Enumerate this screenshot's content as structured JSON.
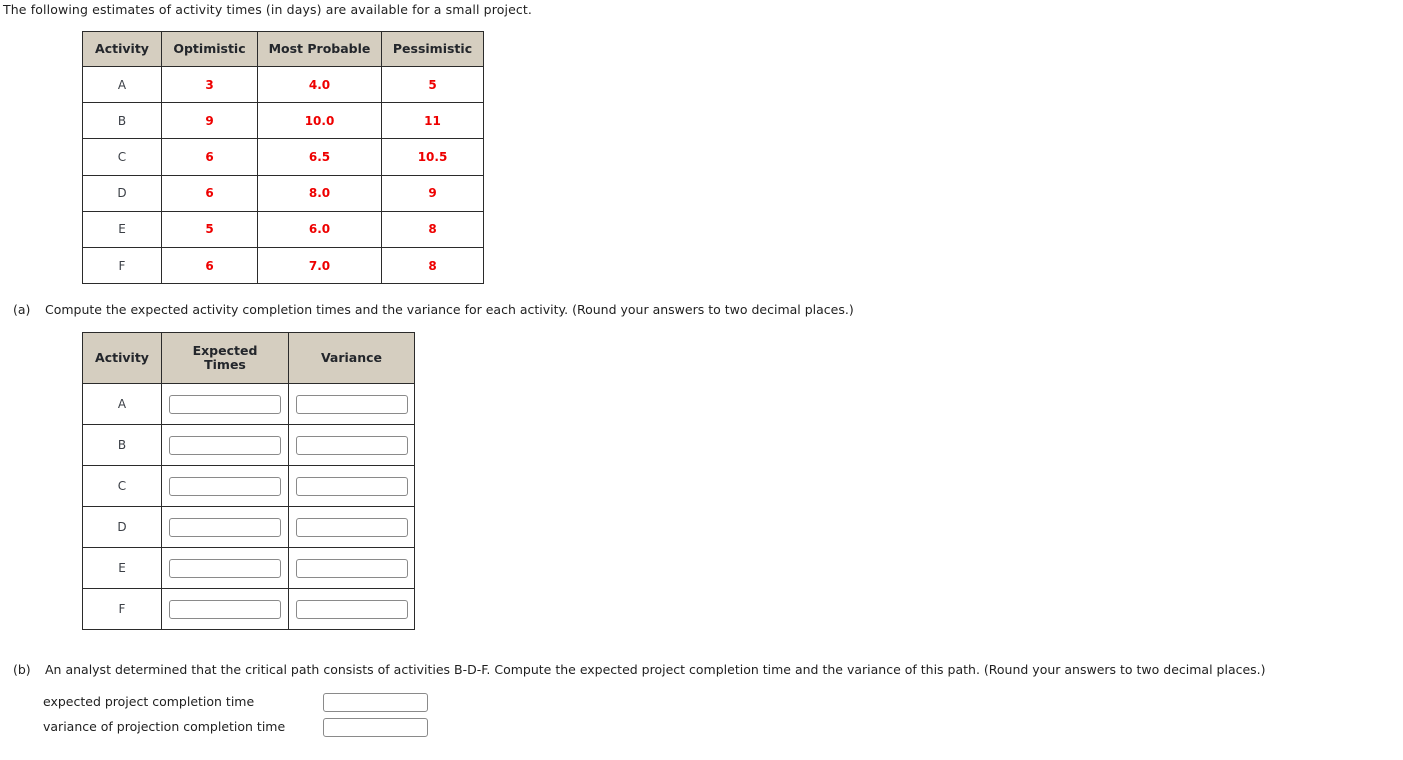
{
  "intro": "The following estimates of activity times (in days) are available for a small project.",
  "colors": {
    "header_background": "#d5cec0",
    "value_text": "#ee0000",
    "border": "#2b2b2b",
    "input_border": "#8a8a8a"
  },
  "estimates_table": {
    "headers": [
      "Activity",
      "Optimistic",
      "Most Probable",
      "Pessimistic"
    ],
    "rows": [
      {
        "activity": "A",
        "optimistic": "3",
        "most_probable": "4.0",
        "pessimistic": "5"
      },
      {
        "activity": "B",
        "optimistic": "9",
        "most_probable": "10.0",
        "pessimistic": "11"
      },
      {
        "activity": "C",
        "optimistic": "6",
        "most_probable": "6.5",
        "pessimistic": "10.5"
      },
      {
        "activity": "D",
        "optimistic": "6",
        "most_probable": "8.0",
        "pessimistic": "9"
      },
      {
        "activity": "E",
        "optimistic": "5",
        "most_probable": "6.0",
        "pessimistic": "8"
      },
      {
        "activity": "F",
        "optimistic": "6",
        "most_probable": "7.0",
        "pessimistic": "8"
      }
    ]
  },
  "question_a": {
    "label": "(a)",
    "text": "Compute the expected activity completion times and the variance for each activity. (Round your answers to two decimal places.)"
  },
  "answers_table": {
    "headers": {
      "activity": "Activity",
      "expected_line1": "Expected",
      "expected_line2": "Times",
      "variance": "Variance"
    },
    "rows": [
      {
        "activity": "A",
        "expected_value": "",
        "variance_value": ""
      },
      {
        "activity": "B",
        "expected_value": "",
        "variance_value": ""
      },
      {
        "activity": "C",
        "expected_value": "",
        "variance_value": ""
      },
      {
        "activity": "D",
        "expected_value": "",
        "variance_value": ""
      },
      {
        "activity": "E",
        "expected_value": "",
        "variance_value": ""
      },
      {
        "activity": "F",
        "expected_value": "",
        "variance_value": ""
      }
    ]
  },
  "question_b": {
    "label": "(b)",
    "text": "An analyst determined that the critical path consists of activities B-D-F. Compute the expected project completion time and the variance of this path. (Round your answers to two decimal places.)",
    "expected_label": "expected project completion time",
    "expected_value": "",
    "variance_label": "variance of projection completion time",
    "variance_value": ""
  }
}
